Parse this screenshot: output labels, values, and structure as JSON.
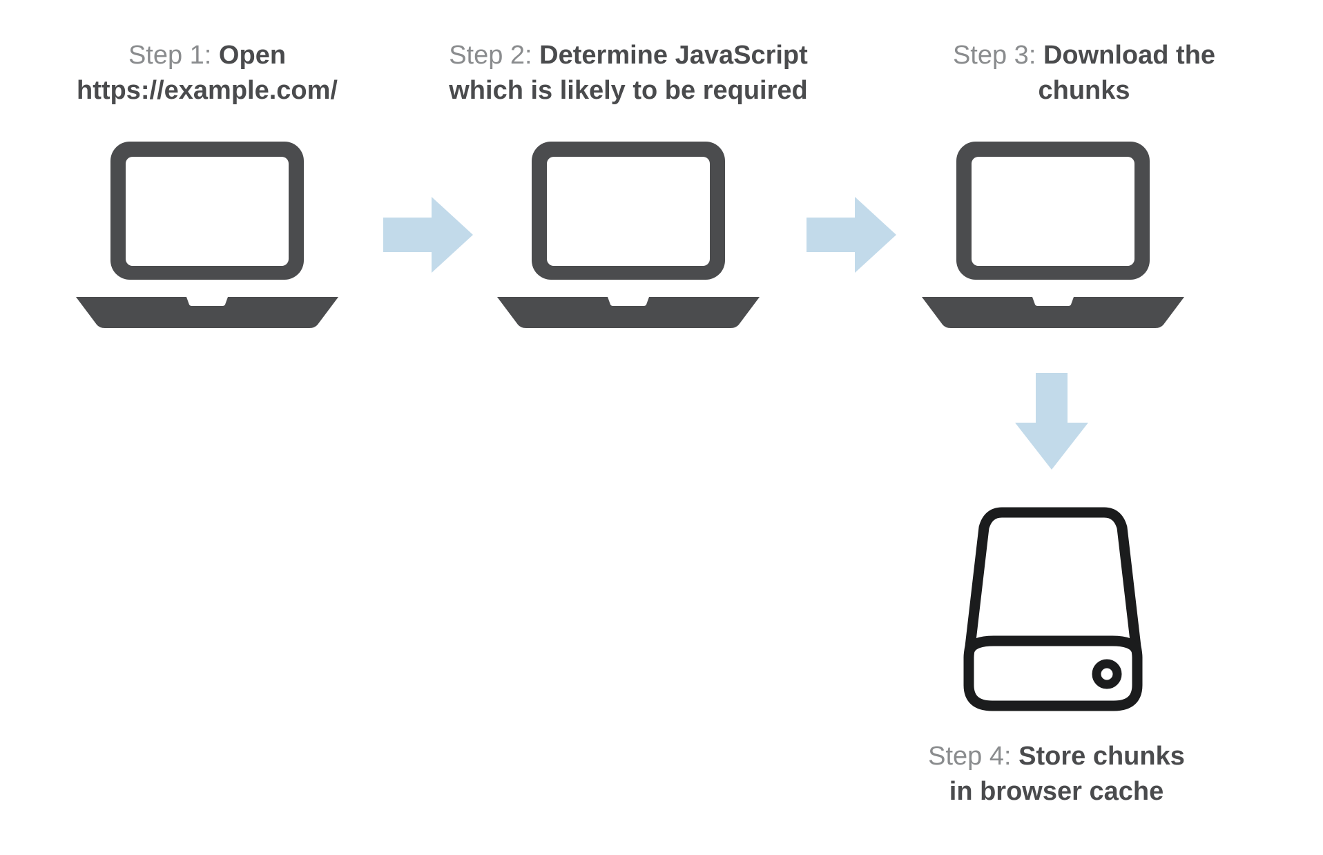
{
  "colors": {
    "icon_dark": "#4b4c4e",
    "text_light": "#8a8c8e",
    "text_bold": "#4a4b4d",
    "arrow_fill": "#c2daea",
    "disk_stroke": "#1b1c1d"
  },
  "steps": {
    "s1": {
      "prefix": "Step 1: ",
      "bold_line1": "Open",
      "bold_line2": "https://example.com/"
    },
    "s2": {
      "prefix": "Step 2: ",
      "bold_line1": "Determine JavaScript",
      "bold_line2": "which is likely to be required"
    },
    "s3": {
      "prefix": "Step 3: ",
      "bold_line1": "Download the",
      "bold_line2": "chunks"
    },
    "s4": {
      "prefix": "Step 4: ",
      "bold_line1": "Store chunks",
      "bold_line2": "in browser cache"
    }
  }
}
